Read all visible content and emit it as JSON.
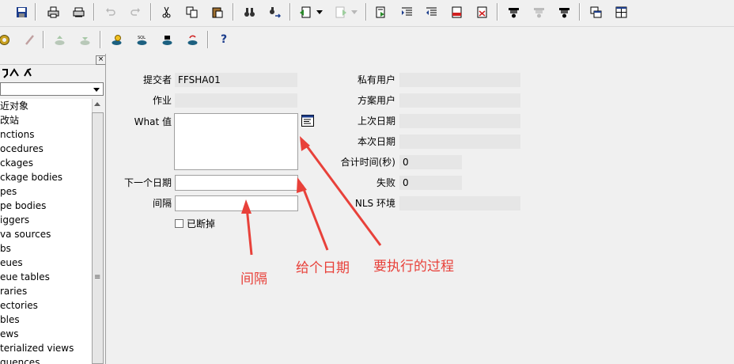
{
  "toolbar1": {
    "icons": [
      "save-icon",
      "print-icon",
      "print-preview-icon",
      "undo-icon",
      "redo-icon",
      "cut-icon",
      "copy-icon",
      "paste-icon",
      "find-icon",
      "find-next-icon",
      "back-icon",
      "forward-icon",
      "query-icon",
      "indent-icon",
      "outdent-icon",
      "comment-icon",
      "uncomment-icon",
      "execute-icon",
      "step-icon",
      "debug-icon",
      "windows-icon",
      "tile-icon"
    ]
  },
  "toolbar2": {
    "icons": [
      "compile-icon",
      "disable-icon",
      "db-upload-icon",
      "db-download-icon",
      "db-connect-icon",
      "sql-icon",
      "db-run-icon",
      "db-refresh-icon"
    ],
    "help_label": "?"
  },
  "left_panel": {
    "close_label": "×",
    "items": [
      "近对象",
      "改站",
      "nctions",
      "ocedures",
      "ckages",
      "ckage bodies",
      "pes",
      "pe bodies",
      "iggers",
      "va sources",
      "bs",
      "eues",
      "eue tables",
      "raries",
      "ectories",
      "bles",
      "ews",
      "terialized views",
      "quences"
    ]
  },
  "form": {
    "submitter": {
      "label": "提交者",
      "value": "FFSHA01"
    },
    "job": {
      "label": "作业",
      "value": ""
    },
    "what": {
      "label": "What 值",
      "value": ""
    },
    "next_date": {
      "label": "下一个日期",
      "value": ""
    },
    "interval": {
      "label": "间隔",
      "value": ""
    },
    "broken": {
      "label": "已断掉"
    },
    "private_user": {
      "label": "私有用户",
      "value": ""
    },
    "schema_user": {
      "label": "方案用户",
      "value": ""
    },
    "last_date": {
      "label": "上次日期",
      "value": ""
    },
    "this_date": {
      "label": "本次日期",
      "value": ""
    },
    "total_time": {
      "label": "合计时间(秒)",
      "value": "0"
    },
    "failures": {
      "label": "失败",
      "value": "0"
    },
    "nls_env": {
      "label": "NLS 环境",
      "value": ""
    }
  },
  "annotations": {
    "interval": "间隔",
    "date": "给个日期",
    "process": "要执行的过程",
    "color": "#e8413a"
  }
}
